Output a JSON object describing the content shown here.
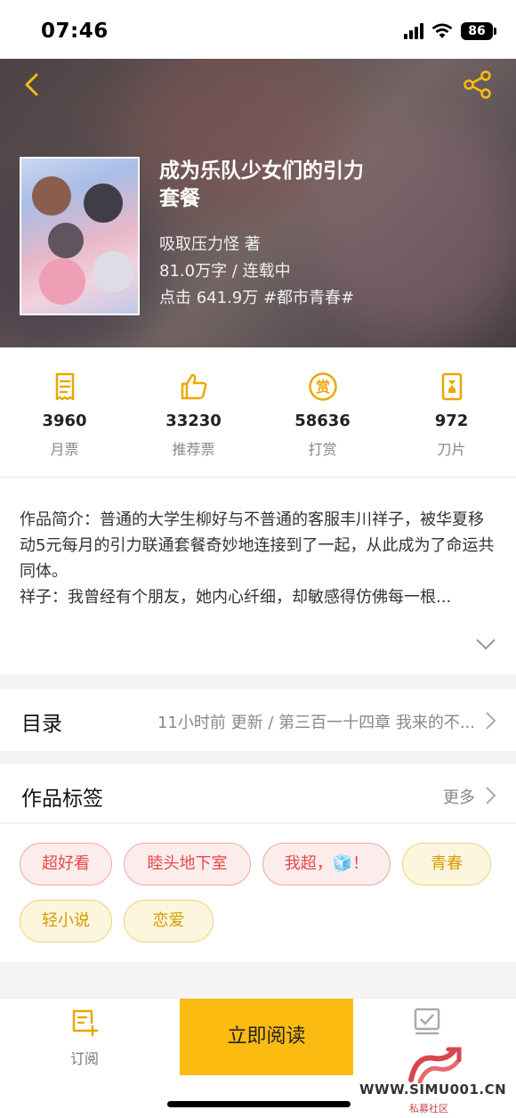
{
  "status": {
    "time": "07:46",
    "battery": "86"
  },
  "book": {
    "title": "成为乐队少女们的引力套餐",
    "author": "吸取压力怪  著",
    "words_status": "81.0万字 / 连载中",
    "clicks_tag": "点击 641.9万  #都市青春#"
  },
  "stats": [
    {
      "value": "3960",
      "label": "月票",
      "icon": "ticket-icon"
    },
    {
      "value": "33230",
      "label": "推荐票",
      "icon": "thumb-up-icon"
    },
    {
      "value": "58636",
      "label": "打赏",
      "icon": "reward-coin-icon"
    },
    {
      "value": "972",
      "label": "刀片",
      "icon": "blade-icon"
    }
  ],
  "intro": {
    "line1": "作品简介：普通的大学生柳好与不普通的客服丰川祥子，被华夏移动5元每月的引力联通套餐奇妙地连接到了一起，从此成为了命运共同体。",
    "line2": "祥子：我曾经有个朋友，她内心纤细，却敏感得仿佛每一根..."
  },
  "catalog": {
    "title": "目录",
    "info": "11小时前 更新 / 第三百一十四章 我来的不..."
  },
  "tags_section": {
    "title": "作品标签",
    "more": "更多"
  },
  "tags": [
    "超好看",
    "睦头地下室",
    "我超，🧊！",
    "青春",
    "轻小说",
    "恋爱"
  ],
  "bottom": {
    "subscribe": "订阅",
    "read_now": "立即阅读"
  },
  "watermark": {
    "url": "WWW.SIMU001.CN",
    "sub": "私募社区"
  },
  "colors": {
    "accent": "#fbbb10",
    "icon_yellow": "#e9a800",
    "tag_red": "#e24a4a",
    "tag_yellow": "#d59c00"
  }
}
